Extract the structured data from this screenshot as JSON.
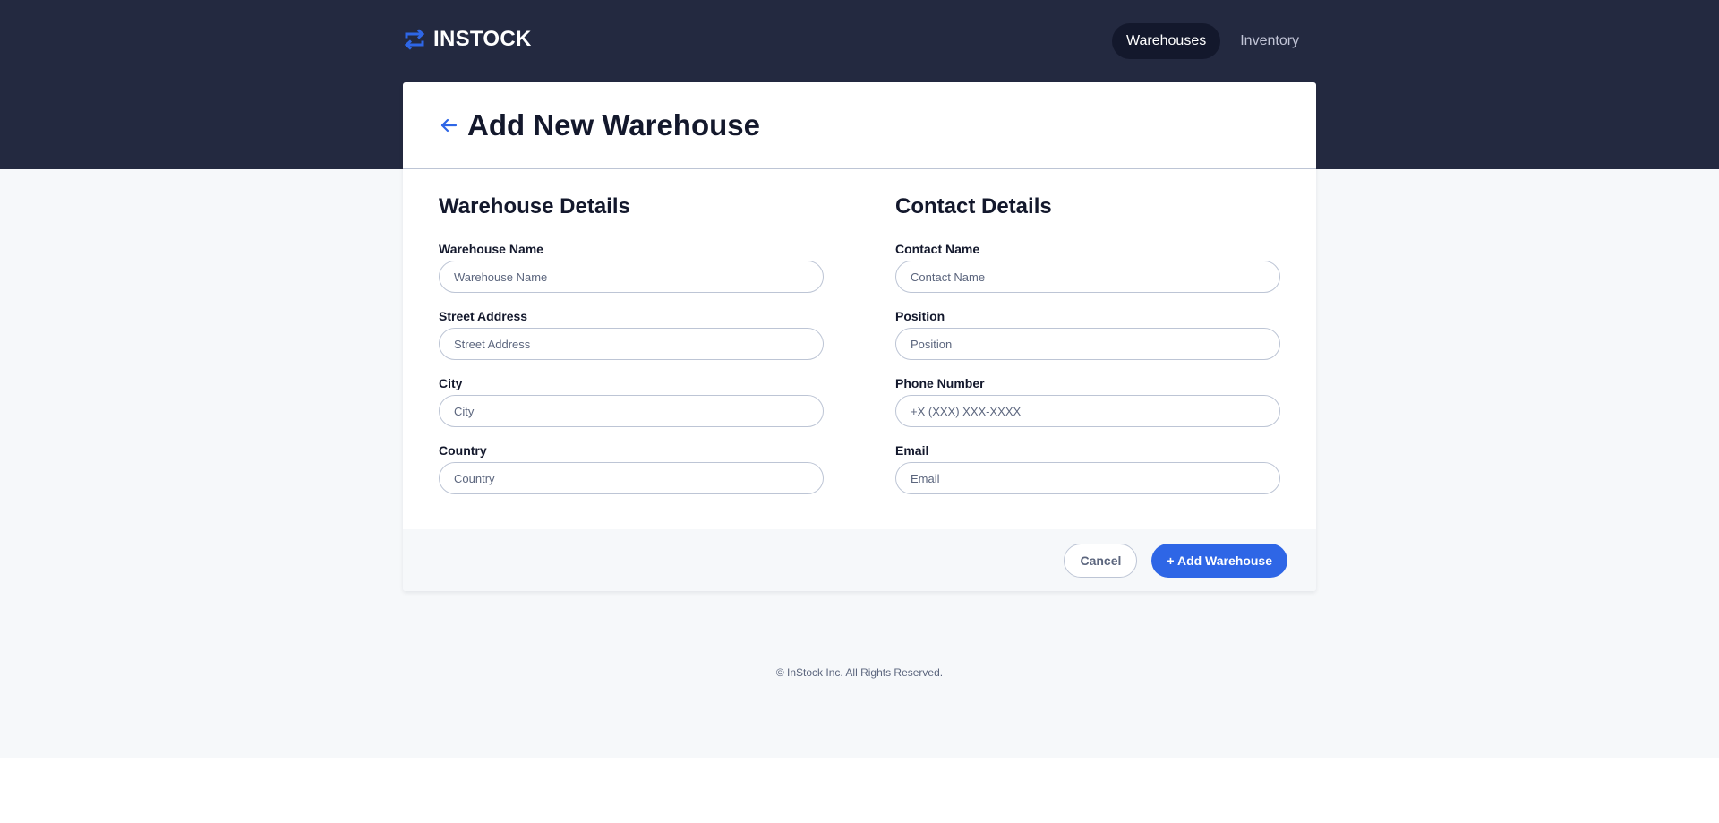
{
  "brand": {
    "name": "INSTOCK",
    "logo_icon": "swap-arrows-icon",
    "accent": "#2e66e6"
  },
  "nav": {
    "items": [
      {
        "label": "Warehouses",
        "active": true
      },
      {
        "label": "Inventory",
        "active": false
      }
    ]
  },
  "page": {
    "title": "Add New Warehouse",
    "back_icon": "arrow-left-icon"
  },
  "warehouse_details": {
    "heading": "Warehouse Details",
    "fields": [
      {
        "label": "Warehouse Name",
        "placeholder": "Warehouse Name",
        "value": ""
      },
      {
        "label": "Street Address",
        "placeholder": "Street Address",
        "value": ""
      },
      {
        "label": "City",
        "placeholder": "City",
        "value": ""
      },
      {
        "label": "Country",
        "placeholder": "Country",
        "value": ""
      }
    ]
  },
  "contact_details": {
    "heading": "Contact Details",
    "fields": [
      {
        "label": "Contact Name",
        "placeholder": "Contact Name",
        "value": ""
      },
      {
        "label": "Position",
        "placeholder": "Position",
        "value": ""
      },
      {
        "label": "Phone Number",
        "placeholder": "+X (XXX) XXX-XXXX",
        "value": ""
      },
      {
        "label": "Email",
        "placeholder": "Email",
        "value": ""
      }
    ]
  },
  "actions": {
    "cancel_label": "Cancel",
    "add_label": "+ Add Warehouse"
  },
  "footer": {
    "text": "© InStock Inc. All Rights Reserved."
  },
  "colors": {
    "header_bg": "#232940",
    "page_bg": "#f6f8fa",
    "primary_text": "#13182c",
    "secondary_text": "#5c667e",
    "border": "#bdc5d5"
  }
}
